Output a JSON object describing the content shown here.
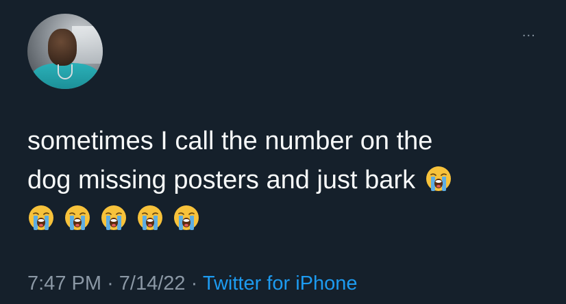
{
  "tweet": {
    "line1": "sometimes I call the number on the",
    "line2": "dog missing posters and just bark",
    "emoji_name": "loudly-crying-face",
    "emoji_count_inline": 1,
    "emoji_count_row": 5,
    "time": "7:47 PM",
    "sep": "·",
    "date": "7/14/22",
    "source": "Twitter for iPhone"
  },
  "header": {
    "more": "···"
  },
  "colors": {
    "background": "#15202b",
    "text": "#f7f9f9",
    "secondary": "#8b98a5",
    "link": "#1d9bf0"
  }
}
